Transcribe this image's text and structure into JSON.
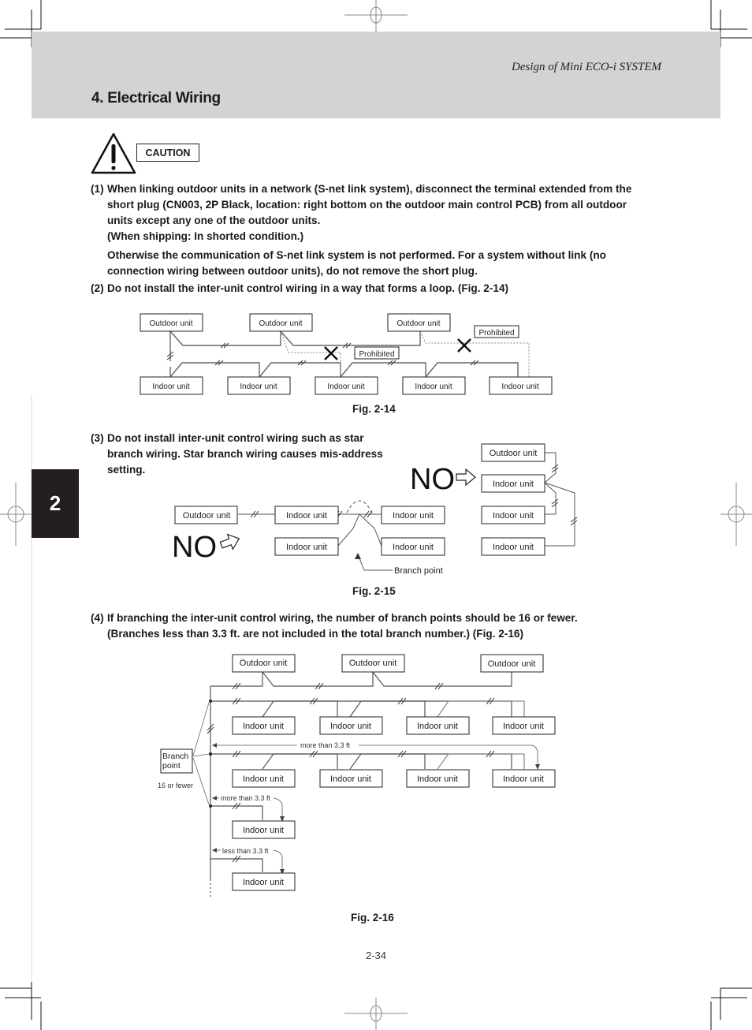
{
  "header": {
    "running_head": "Design of Mini ECO-i SYSTEM",
    "section_title": "4. Electrical Wiring",
    "chapter_tab": "2"
  },
  "caution": {
    "icon": "warning-triangle-icon",
    "label": "CAUTION"
  },
  "items": [
    {
      "num": "(1)",
      "lines": [
        "When linking outdoor units in a network (S-net link system), disconnect the terminal extended from the",
        "short plug (CN003, 2P Black, location: right bottom on the outdoor main control PCB) from all outdoor",
        "units except any one of the outdoor units.",
        "(When shipping: In shorted condition.)"
      ],
      "extra_lines": [
        "Otherwise the communication of S-net link system is not performed. For a system without link (no",
        "connection wiring between outdoor units), do not remove the short plug."
      ]
    },
    {
      "num": "(2)",
      "lines": [
        "Do not install the inter-unit control wiring in a way that forms a loop. (Fig. 2-14)"
      ]
    },
    {
      "num": "(3)",
      "lines": [
        "Do not install inter-unit control wiring such as star",
        "branch wiring. Star branch wiring causes mis-address",
        "setting."
      ]
    },
    {
      "num": "(4)",
      "lines": [
        "If branching the inter-unit control wiring, the number of branch points should be 16 or fewer.",
        "(Branches less than 3.3 ft. are not included in the total branch number.) (Fig. 2-16)"
      ]
    }
  ],
  "fig14": {
    "caption": "Fig. 2-14",
    "outdoor_label": "Outdoor unit",
    "indoor_label": "Indoor unit",
    "prohibited_label": "Prohibited"
  },
  "fig15": {
    "caption": "Fig. 2-15",
    "outdoor_label": "Outdoor unit",
    "indoor_label": "Indoor unit",
    "no_label": "NO",
    "branch_point_label": "Branch point"
  },
  "fig16": {
    "caption": "Fig. 2-16",
    "outdoor_label": "Outdoor unit",
    "indoor_label": "Indoor unit",
    "branch_point_label_1": "Branch",
    "branch_point_label_2": "point",
    "count_label": "16 or fewer",
    "more_than_label": "more than 3.3 ft",
    "less_than_label": "less than 3.3 ft"
  },
  "footer": {
    "page_number": "2-34"
  }
}
